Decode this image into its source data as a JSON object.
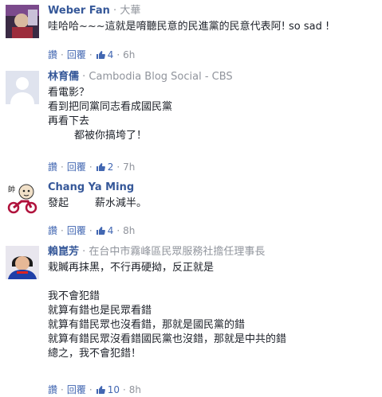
{
  "comments": [
    {
      "author": "Weber Fan",
      "affiliation": "大華",
      "text": "哇哈哈~~~這就是唷聽民意的民進黨的民意代表阿! so sad !",
      "actions": {
        "like": "讚",
        "reply": "回覆",
        "like_count": "4",
        "time": "6h"
      }
    },
    {
      "author": "林育儒",
      "affiliation": "Cambodia Blog Social - CBS",
      "text": "看電影？\n看到把同黨同志看成國民黨\n再看下去\n        都被你搞垮了！",
      "actions": {
        "like": "讚",
        "reply": "回覆",
        "like_count": "2",
        "time": "7h"
      }
    },
    {
      "author": "Chang Ya Ming",
      "affiliation": "",
      "text": "發起        薪水減半。",
      "actions": {
        "like": "讚",
        "reply": "回覆",
        "like_count": "4",
        "time": "8h"
      }
    },
    {
      "author": "賴崑芳",
      "affiliation": "在台中市霧峰區民眾服務社擔任理事長",
      "text": "栽贓再抹黑，不行再硬拗，反正就是\n\n我不會犯錯\n就算有錯也是民眾看錯\n就算有錯民眾也沒看錯，那就是國民黨的錯\n就算有錯民眾沒看錯國民黨也沒錯，那就是中共的錯\n總之，我不會犯錯！",
      "actions": {
        "like": "讚",
        "reply": "回覆",
        "like_count": "10",
        "time": "8h"
      }
    }
  ],
  "colors": {
    "link": "#365899",
    "meta_link": "#4267b2",
    "muted": "#90949c"
  },
  "icons": {
    "like": "thumbs-up-icon"
  }
}
